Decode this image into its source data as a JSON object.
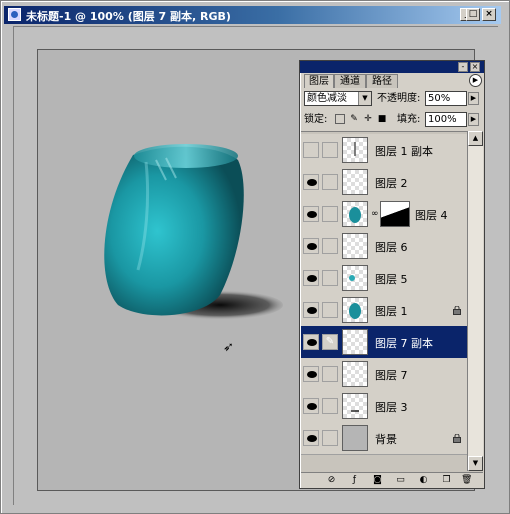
{
  "window": {
    "title": "未标题-1 @ 100% (图层 7 副本, RGB)",
    "buttons": [
      "_",
      "□",
      "×"
    ]
  },
  "layers_panel": {
    "tabs": [
      "图层",
      "通道",
      "路径"
    ],
    "blend_mode": "颜色减淡",
    "opacity_label": "不透明度:",
    "opacity_value": "50%",
    "lock_label": "锁定:",
    "fill_label": "填充:",
    "fill_value": "100%",
    "layers": [
      {
        "name": "图层 1 副本",
        "visible": false,
        "selected": false,
        "locked": false,
        "thumb": "line"
      },
      {
        "name": "图层 2",
        "visible": true,
        "selected": false,
        "locked": false,
        "thumb": "empty"
      },
      {
        "name": "图层 4",
        "visible": true,
        "selected": false,
        "locked": false,
        "thumb": "vase",
        "has_mask": true
      },
      {
        "name": "图层 6",
        "visible": true,
        "selected": false,
        "locked": false,
        "thumb": "empty"
      },
      {
        "name": "图层 5",
        "visible": true,
        "selected": false,
        "locked": false,
        "thumb": "dot"
      },
      {
        "name": "图层 1",
        "visible": true,
        "selected": false,
        "locked": true,
        "thumb": "vase"
      },
      {
        "name": "图层 7 副本",
        "visible": true,
        "selected": true,
        "locked": false,
        "thumb": "empty"
      },
      {
        "name": "图层 7",
        "visible": true,
        "selected": false,
        "locked": false,
        "thumb": "empty"
      },
      {
        "name": "图层 3",
        "visible": true,
        "selected": false,
        "locked": false,
        "thumb": "dash"
      },
      {
        "name": "背景",
        "visible": true,
        "selected": false,
        "locked": true,
        "thumb": "bg"
      }
    ],
    "bottom_icons": [
      "link-icon",
      "add-style-icon",
      "add-mask-icon",
      "new-set-icon",
      "adjustment-layer-icon",
      "new-layer-icon",
      "trash-icon"
    ]
  },
  "colors": {
    "title_bar": "#0a246a",
    "canvas_bg": "#b5b5b5",
    "vase_teal": "#1f9aa6",
    "selection": "#0a246a"
  }
}
